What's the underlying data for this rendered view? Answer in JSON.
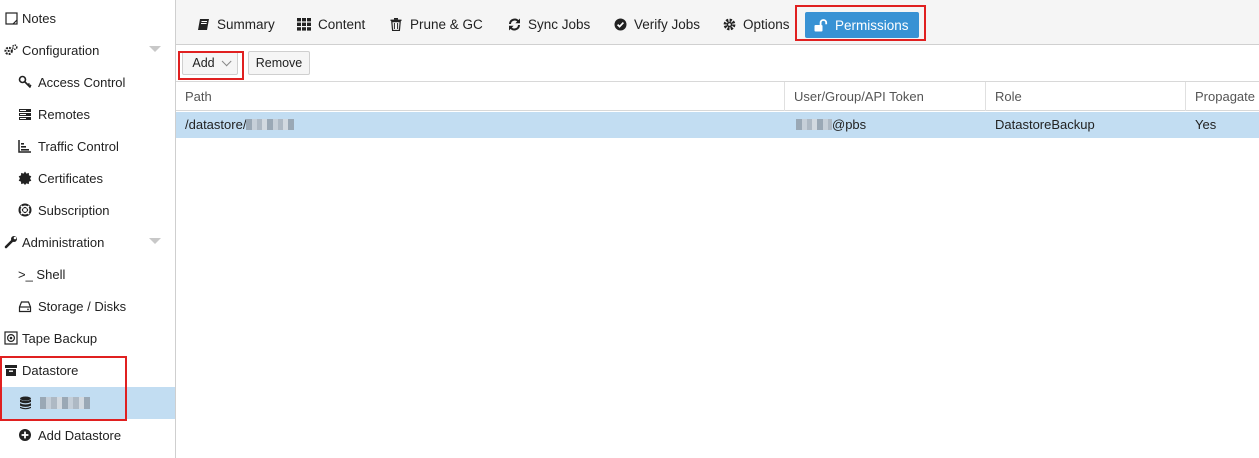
{
  "sidebar": {
    "items": [
      {
        "label": "Notes",
        "icon": "notes-icon"
      },
      {
        "label": "Configuration",
        "icon": "gears-icon",
        "expandable": true
      },
      {
        "label": "Access Control",
        "icon": "key-icon"
      },
      {
        "label": "Remotes",
        "icon": "server-icon"
      },
      {
        "label": "Traffic Control",
        "icon": "bar-chart-icon"
      },
      {
        "label": "Certificates",
        "icon": "certificate-icon"
      },
      {
        "label": "Subscription",
        "icon": "life-ring-icon"
      },
      {
        "label": "Administration",
        "icon": "wrench-icon",
        "expandable": true
      },
      {
        "label": ">_ Shell",
        "icon": "terminal-icon"
      },
      {
        "label": "Storage / Disks",
        "icon": "hdd-icon"
      },
      {
        "label": "Tape Backup",
        "icon": "tape-icon"
      },
      {
        "label": "Datastore",
        "icon": "archive-icon"
      },
      {
        "label": "",
        "icon": "database-icon",
        "selected": true
      },
      {
        "label": "Add Datastore",
        "icon": "plus-circle-icon"
      }
    ]
  },
  "tabs": [
    {
      "label": "Summary",
      "icon": "book-icon"
    },
    {
      "label": "Content",
      "icon": "grid-icon"
    },
    {
      "label": "Prune & GC",
      "icon": "trash-icon"
    },
    {
      "label": "Sync Jobs",
      "icon": "sync-icon"
    },
    {
      "label": "Verify Jobs",
      "icon": "check-circle-icon"
    },
    {
      "label": "Options",
      "icon": "gear-icon"
    },
    {
      "label": "Permissions",
      "icon": "unlock-icon",
      "active": true
    }
  ],
  "toolbar": {
    "add_label": "Add",
    "remove_label": "Remove"
  },
  "grid": {
    "columns": [
      "Path",
      "User/Group/API Token",
      "Role",
      "Propagate"
    ],
    "rows": [
      {
        "path": "/datastore/",
        "user": "@pbs",
        "role": "DatastoreBackup",
        "propagate": "Yes"
      }
    ]
  },
  "colors": {
    "accent": "#3892d4",
    "selection": "#c2ddf2",
    "highlight_box": "#e02020"
  }
}
